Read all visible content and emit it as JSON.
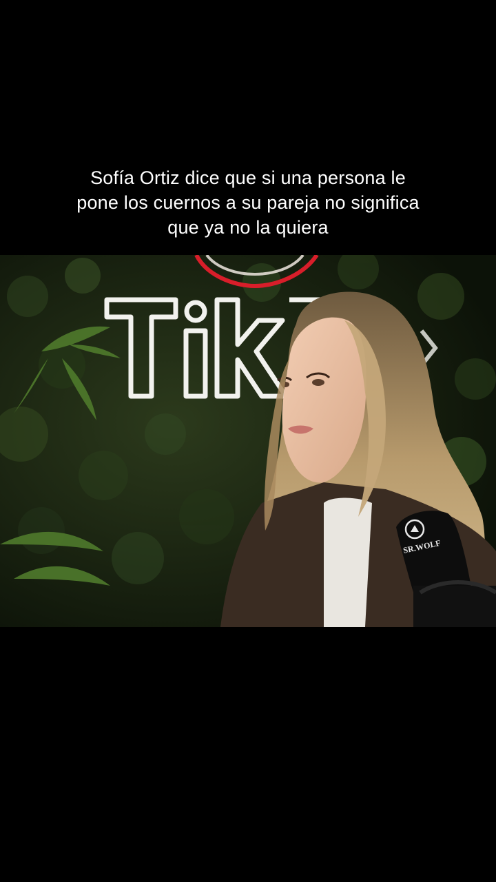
{
  "caption": {
    "text": "Sofía Ortiz dice que si una persona le\npone los cuernos a su pareja no significa\nque ya no la quiera"
  },
  "video": {
    "background_color": "#000000",
    "foliage_color": "#1f2a14",
    "sign_text": "TikT",
    "sign_color": "#f2f2ee",
    "neon_ring_color": "#d81e2a",
    "mic_logo_text": "SR.WOLF",
    "mic_color": "#0d0d0d"
  }
}
